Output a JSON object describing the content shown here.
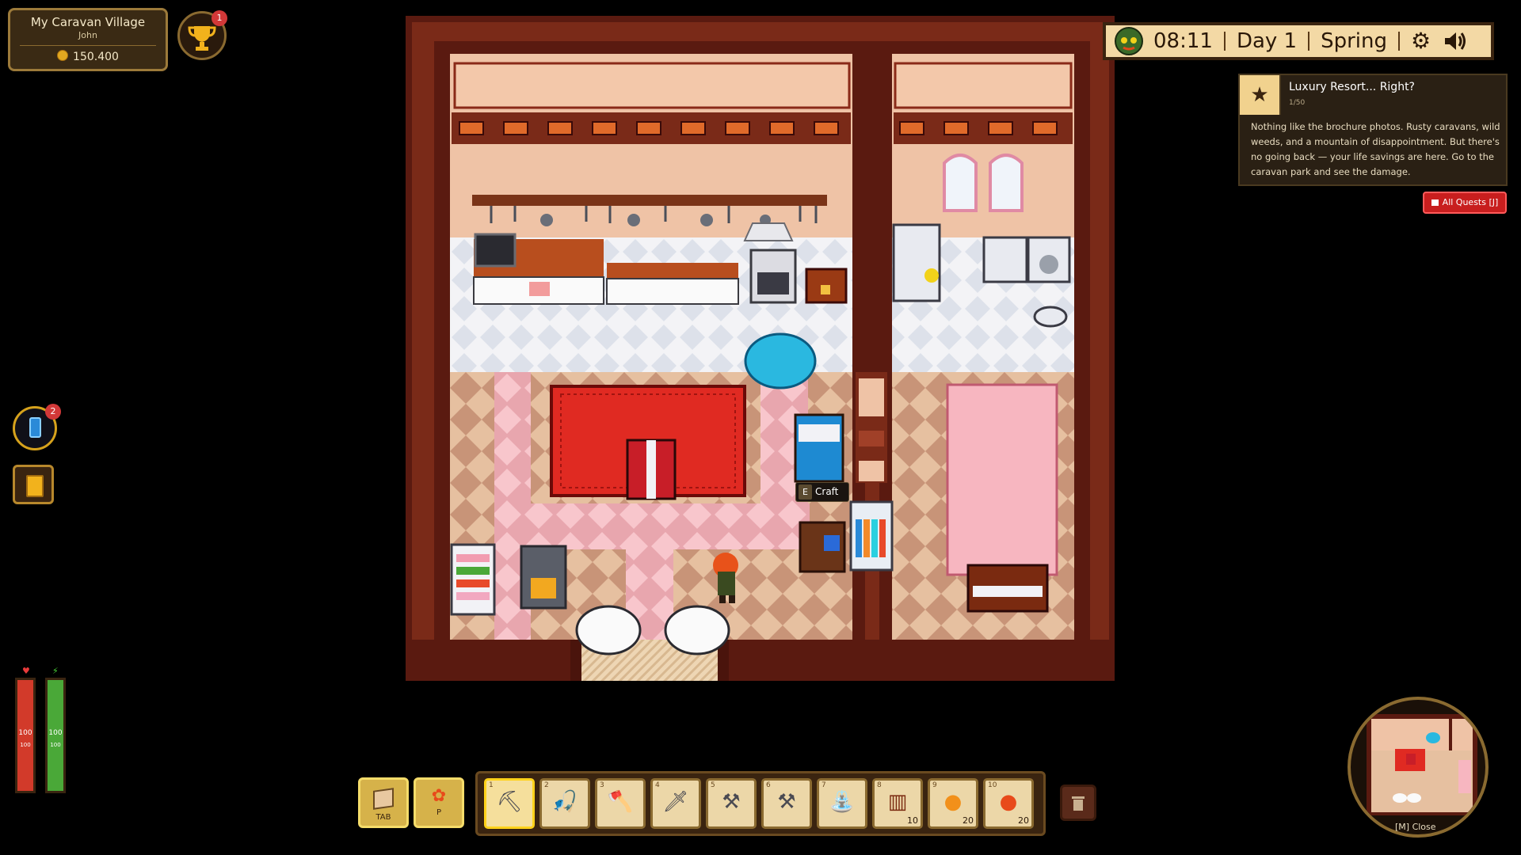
{
  "village": {
    "name": "My Caravan Village",
    "owner": "John",
    "money": "150.400"
  },
  "achievements": {
    "badge": "1",
    "icon": "trophy-icon"
  },
  "hud": {
    "time": "08:11",
    "day": "Day 1",
    "season": "Spring",
    "icons": [
      "tanuki-icon",
      "gear-icon",
      "speaker-icon"
    ]
  },
  "quest": {
    "title": "Luxury Resort... Right?",
    "progress": "1/50",
    "description": "Nothing like the brochure photos. Rusty caravans, wild weeds, and a mountain of disappointment. But there's no going back — your life savings are here. Go to the caravan park and see the damage.",
    "all_quests_label": "All Quests",
    "all_quests_key": "[J]"
  },
  "side": {
    "phone_badge": "2"
  },
  "stats": {
    "health": {
      "value": "100",
      "max": "100",
      "fill": 1.0,
      "color": "#d23a2a"
    },
    "energy": {
      "value": "100",
      "max": "100",
      "fill": 1.0,
      "color": "#4aa838"
    }
  },
  "prompt": {
    "key": "E",
    "label": "Craft"
  },
  "menu_buttons": [
    {
      "label": "TAB",
      "icon": "inventory-box-icon"
    },
    {
      "label": "P",
      "icon": "paw-icon"
    }
  ],
  "hotbar": {
    "selected": 1,
    "slots": [
      {
        "num": "1",
        "icon": "pickaxe-icon",
        "qty": ""
      },
      {
        "num": "2",
        "icon": "fishing-rod-icon",
        "qty": ""
      },
      {
        "num": "3",
        "icon": "axe-icon",
        "qty": ""
      },
      {
        "num": "4",
        "icon": "sword-icon",
        "qty": ""
      },
      {
        "num": "5",
        "icon": "shovel-icon",
        "qty": ""
      },
      {
        "num": "6",
        "icon": "hoe-icon",
        "qty": ""
      },
      {
        "num": "7",
        "icon": "watering-can-icon",
        "qty": ""
      },
      {
        "num": "8",
        "icon": "bed-item-icon",
        "qty": "10"
      },
      {
        "num": "9",
        "icon": "orange-fruit-icon",
        "qty": "20"
      },
      {
        "num": "10",
        "icon": "strawberry-jar-icon",
        "qty": "20"
      }
    ]
  },
  "minimap": {
    "close_label": "[M] Close"
  }
}
